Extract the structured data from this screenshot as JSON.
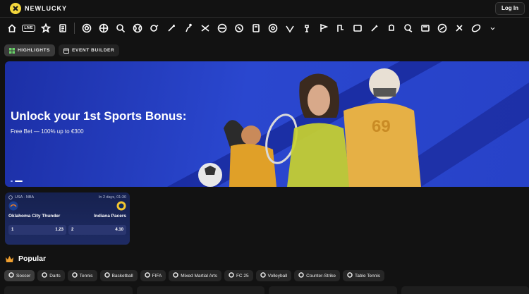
{
  "app": {
    "brand": "NEWLUCKY",
    "login_label": "Log In"
  },
  "sports_nav": {
    "live_label": "LIVE",
    "icons": [
      "home-icon",
      "live-icon",
      "star-icon",
      "betslip-icon",
      "soccer-icon",
      "basketball-icon",
      "tennis-icon",
      "volleyball-icon",
      "baseball-icon",
      "hockey-icon",
      "cricket-icon",
      "esports-icon",
      "handball-icon",
      "rugby-icon",
      "mma-icon",
      "table-tennis-icon",
      "cycling-icon",
      "chess-icon",
      "formula-icon",
      "golf-icon",
      "football-icon",
      "darts-icon",
      "boxing-icon",
      "american-football-icon",
      "nba2k-icon",
      "snooker-icon",
      "badminton-icon",
      "rugby-ball-icon"
    ]
  },
  "modes": [
    {
      "label": "HIGHLIGHTS",
      "active": true
    },
    {
      "label": "EVENT BUILDER",
      "active": false
    }
  ],
  "banner": {
    "title": "Unlock your 1st Sports Bonus:",
    "subtitle": "Free Bet — 100% up to €300"
  },
  "match": {
    "league": "USA · NBA",
    "time": "In 2 days, 01:30",
    "home": "Oklahoma City Thunder",
    "away": "Indiana Pacers",
    "odds": [
      {
        "label": "1",
        "value": "1.23"
      },
      {
        "label": "2",
        "value": "4.10"
      }
    ]
  },
  "popular": {
    "title": "Popular",
    "chips": [
      {
        "label": "Soccer",
        "icon": "soccer-icon",
        "active": true
      },
      {
        "label": "Darts",
        "icon": "darts-icon"
      },
      {
        "label": "Tennis",
        "icon": "tennis-icon"
      },
      {
        "label": "Basketball",
        "icon": "basketball-icon"
      },
      {
        "label": "FIFA",
        "icon": "fifa-icon"
      },
      {
        "label": "Mixed Martial Arts",
        "icon": "mma-icon"
      },
      {
        "label": "FC 25",
        "icon": "fc-icon"
      },
      {
        "label": "Volleyball",
        "icon": "volleyball-icon"
      },
      {
        "label": "Counter-Strike",
        "icon": "cs-icon"
      },
      {
        "label": "Table Tennis",
        "icon": "table-tennis-icon"
      }
    ]
  },
  "colors": {
    "accent": "#2a47cf",
    "logo": "#f4d73c",
    "bg": "#121212"
  }
}
